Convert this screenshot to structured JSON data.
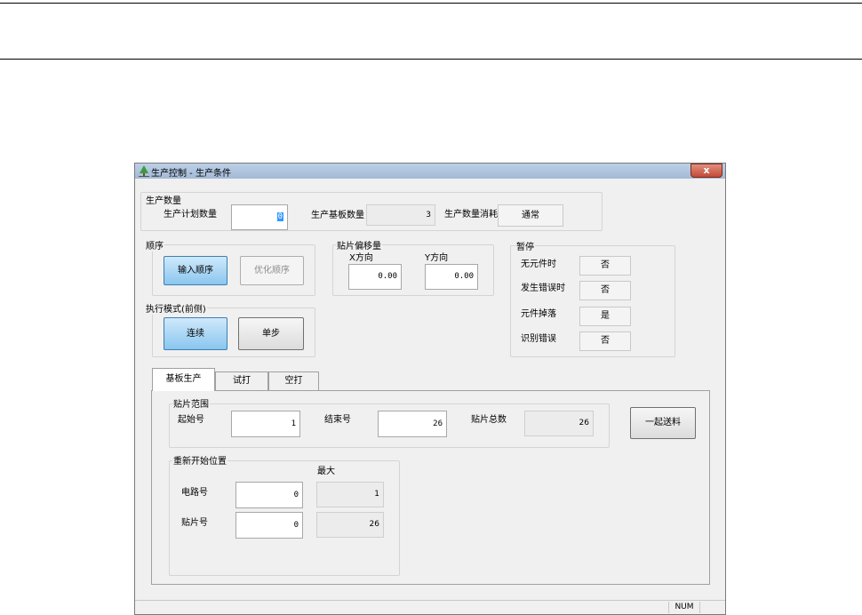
{
  "window": {
    "title": "生产控制 - 生产条件",
    "close_label": "x"
  },
  "production_qty": {
    "group_label": "生产数量",
    "plan_label": "生产计划数量",
    "plan_value": "0",
    "board_qty_label": "生产基板数量",
    "board_qty_value": "3",
    "consume_label": "生产数量消耗",
    "consume_value": "通常"
  },
  "order": {
    "group_label": "顺序",
    "input_order_btn": "输入顺序",
    "optimize_order_btn": "优化顺序"
  },
  "offset": {
    "group_label": "贴片偏移量",
    "x_label": "X方向",
    "x_value": "0.00",
    "y_label": "Y方向",
    "y_value": "0.00"
  },
  "pause": {
    "group_label": "暂停",
    "rows": [
      {
        "label": "无元件时",
        "value": "否"
      },
      {
        "label": "发生错误时",
        "value": "否"
      },
      {
        "label": "元件掉落",
        "value": "是"
      },
      {
        "label": "识别错误",
        "value": "否"
      }
    ]
  },
  "exec_mode": {
    "group_label": "执行模式(前侧)",
    "continuous_btn": "连续",
    "step_btn": "单步"
  },
  "tabs": [
    "基板生产",
    "试打",
    "空打"
  ],
  "range": {
    "group_label": "贴片范围",
    "start_label": "起始号",
    "start_value": "1",
    "end_label": "结束号",
    "end_value": "26",
    "total_label": "贴片总数",
    "total_value": "26",
    "feed_btn": "一起送料"
  },
  "restart": {
    "group_label": "重新开始位置",
    "max_label": "最大",
    "circuit_label": "电路号",
    "circuit_value": "0",
    "circuit_max": "1",
    "place_label": "贴片号",
    "place_value": "0",
    "place_max": "26"
  },
  "status": {
    "num": "NUM"
  }
}
